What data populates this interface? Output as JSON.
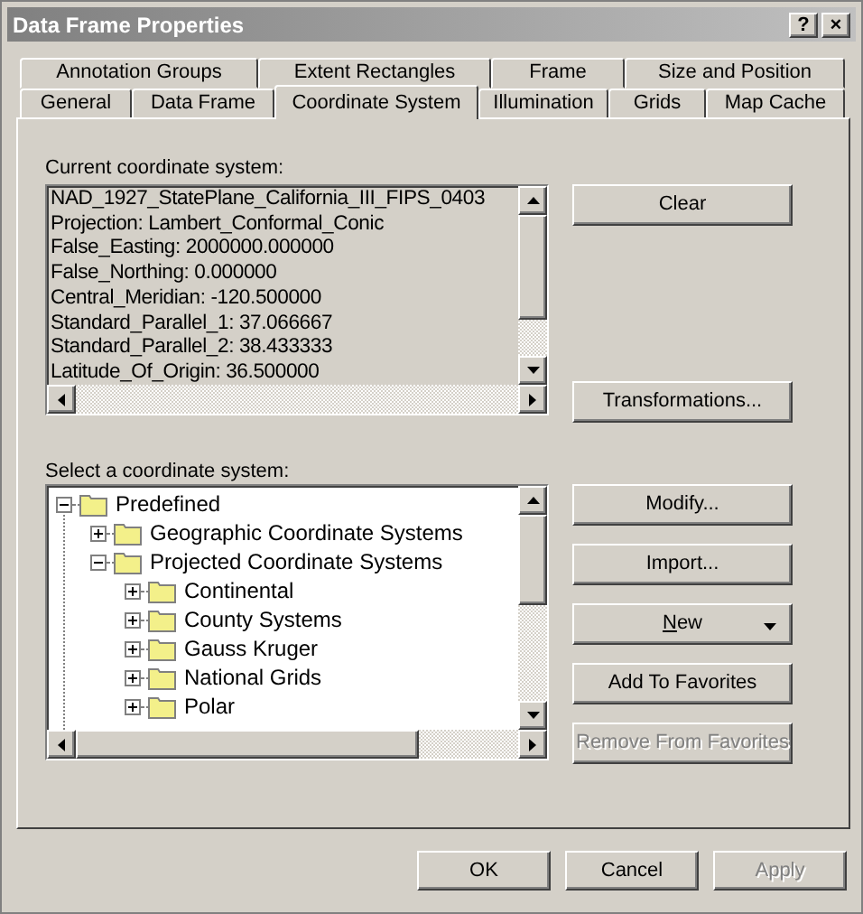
{
  "window": {
    "title": "Data Frame Properties",
    "buttons": [
      "?",
      "×"
    ]
  },
  "tab_rows": [
    [
      {
        "label": "Annotation Groups",
        "selected": false
      },
      {
        "label": "Extent Rectangles",
        "selected": false
      },
      {
        "label": "Frame",
        "selected": false
      },
      {
        "label": "Size and Position",
        "selected": false
      }
    ],
    [
      {
        "label": "General",
        "selected": false
      },
      {
        "label": "Data Frame",
        "selected": false
      },
      {
        "label": "Coordinate System",
        "selected": true
      },
      {
        "label": "Illumination",
        "selected": false
      },
      {
        "label": "Grids",
        "selected": false
      },
      {
        "label": "Map Cache",
        "selected": false
      }
    ]
  ],
  "current": {
    "label": "Current coordinate system:",
    "lines": [
      "NAD_1927_StatePlane_California_III_FIPS_0403",
      "Projection: Lambert_Conformal_Conic",
      "False_Easting: 2000000.000000",
      "False_Northing: 0.000000",
      "Central_Meridian: -120.500000",
      "Standard_Parallel_1: 37.066667",
      "Standard_Parallel_2: 38.433333",
      "Latitude_Of_Origin: 36.500000"
    ],
    "buttons": [
      {
        "label": "Clear",
        "disabled": false
      },
      {
        "label": "Transformations...",
        "disabled": false
      }
    ]
  },
  "select": {
    "label": "Select a coordinate system:",
    "tree": [
      {
        "label": "Predefined",
        "expanded": true,
        "children": [
          {
            "label": "Geographic Coordinate Systems",
            "expanded": false
          },
          {
            "label": "Projected Coordinate Systems",
            "expanded": true,
            "children": [
              {
                "label": "Continental",
                "expanded": false
              },
              {
                "label": "County Systems",
                "expanded": false
              },
              {
                "label": "Gauss Kruger",
                "expanded": false
              },
              {
                "label": "National Grids",
                "expanded": false
              },
              {
                "label": "Polar",
                "expanded": false
              }
            ]
          }
        ]
      }
    ],
    "buttons": [
      {
        "label": "Modify...",
        "disabled": false
      },
      {
        "label": "Import...",
        "disabled": false
      },
      {
        "label": "New",
        "disabled": false,
        "kind": "dropdown",
        "underline_first": true
      },
      {
        "label": "Add To Favorites",
        "disabled": false
      },
      {
        "label": "Remove From Favorites",
        "disabled": true
      }
    ]
  },
  "footer": [
    {
      "label": "OK",
      "disabled": false
    },
    {
      "label": "Cancel",
      "disabled": false
    },
    {
      "label": "Apply",
      "disabled": true
    }
  ]
}
